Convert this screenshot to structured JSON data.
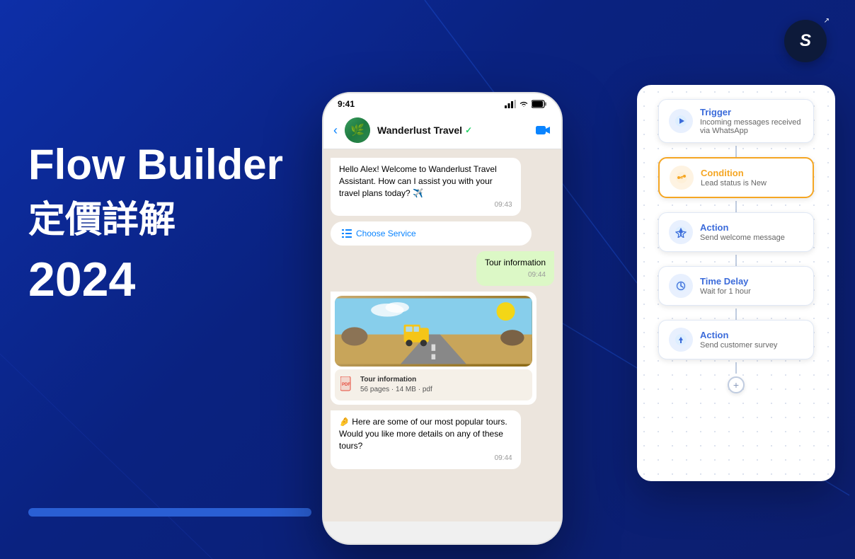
{
  "background": {
    "color_start": "#0d2fa8",
    "color_end": "#0a1e6e"
  },
  "logo": {
    "text": "S",
    "arrow": "↗"
  },
  "hero": {
    "title_line1": "Flow Builder",
    "title_line2": "定價詳解",
    "year": "2024"
  },
  "phone": {
    "status_time": "9:41",
    "contact_name": "Wanderlust Travel",
    "verified": "✓",
    "messages": [
      {
        "type": "received",
        "text": "Hello Alex! Welcome to Wanderlust Travel Assistant. How can I assist you with your travel plans today? ✈️",
        "time": "09:43"
      },
      {
        "type": "button",
        "text": "Choose Service"
      },
      {
        "type": "sent",
        "text": "Tour information",
        "time": "09:44"
      },
      {
        "type": "image_pdf",
        "pdf_name": "Tour information",
        "pdf_detail": "56 pages · 14 MB · pdf"
      },
      {
        "type": "received",
        "text": "🤌 Here are some of our most popular tours. Would you like more details on any of these tours?",
        "time": "09:44"
      }
    ]
  },
  "flow": {
    "nodes": [
      {
        "id": "trigger",
        "type_label": "Trigger",
        "type_class": "trigger-color",
        "description": "Incoming messages received via WhatsApp",
        "icon_class": "blue",
        "icon_symbol": "▶"
      },
      {
        "id": "condition",
        "type_label": "Condition",
        "type_class": "condition-color",
        "description": "Lead status is New",
        "icon_class": "orange",
        "icon_symbol": "⚙"
      },
      {
        "id": "action1",
        "type_label": "Action",
        "type_class": "action-color",
        "description": "Send welcome message",
        "icon_class": "blue",
        "icon_symbol": "⚡"
      },
      {
        "id": "delay",
        "type_label": "Time Delay",
        "type_class": "delay-color",
        "description": "Wait for 1 hour",
        "icon_class": "blue",
        "icon_symbol": "🕐"
      },
      {
        "id": "action2",
        "type_label": "Action",
        "type_class": "action-color",
        "description": "Send customer survey",
        "icon_class": "blue",
        "icon_symbol": "⚡"
      }
    ],
    "plus_button": "+"
  }
}
